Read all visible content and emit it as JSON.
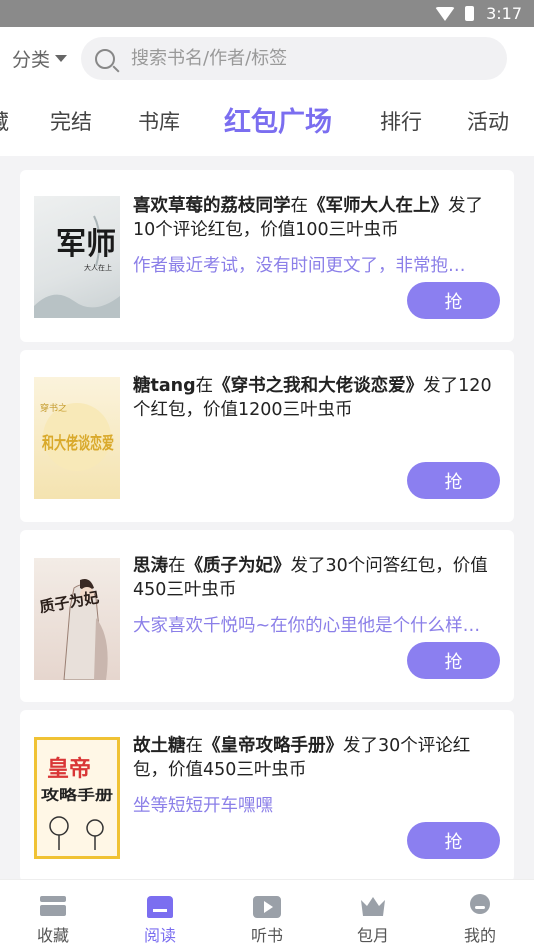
{
  "status": {
    "time": "3:17"
  },
  "search": {
    "category_label": "分类",
    "placeholder": "搜索书名/作者/标签"
  },
  "tabs": [
    {
      "label": "藏"
    },
    {
      "label": "完结"
    },
    {
      "label": "书库"
    },
    {
      "label": "红包广场",
      "active": true
    },
    {
      "label": "排行"
    },
    {
      "label": "活动"
    }
  ],
  "cards": [
    {
      "user": "喜欢草莓的荔枝同学",
      "mid1": "在",
      "book": "《军师大人在上》",
      "rest": "发了10个评论红包，价值100三叶虫币",
      "message": "作者最近考试，没有时间更文了，非常抱…",
      "button": "抢",
      "cover_text": "军师",
      "cover_sub": "大人在上"
    },
    {
      "user": "糖tang",
      "mid1": "在",
      "book": "《穿书之我和大佬谈恋爱》",
      "rest": "发了120个红包，价值1200三叶虫币",
      "message": "",
      "button": "抢",
      "cover_text": "和大佬谈恋爱",
      "cover_sub": "穿书之"
    },
    {
      "user": "思涛",
      "mid1": "在",
      "book": "《质子为妃》",
      "rest": "发了30个问答红包，价值450三叶虫币",
      "message": "大家喜欢千悦吗~在你的心里他是个什么样…",
      "button": "抢",
      "cover_text": "质子为妃",
      "cover_sub": ""
    },
    {
      "user": "故土糖",
      "mid1": "在",
      "book": "《皇帝攻略手册》",
      "rest": "发了30个评论红包，价值450三叶虫币",
      "message": "坐等短短开车嘿嘿",
      "button": "抢",
      "cover_text": "皇帝",
      "cover_sub": "攻略手册"
    }
  ],
  "bottom_nav": [
    {
      "label": "收藏",
      "icon": "bookshelf-icon"
    },
    {
      "label": "阅读",
      "icon": "book-open-icon",
      "active": true
    },
    {
      "label": "听书",
      "icon": "play-icon"
    },
    {
      "label": "包月",
      "icon": "crown-icon"
    },
    {
      "label": "我的",
      "icon": "user-icon"
    }
  ],
  "colors": {
    "accent": "#7b6ef0",
    "button": "#8b7ff0",
    "message": "#8b7fe8"
  }
}
